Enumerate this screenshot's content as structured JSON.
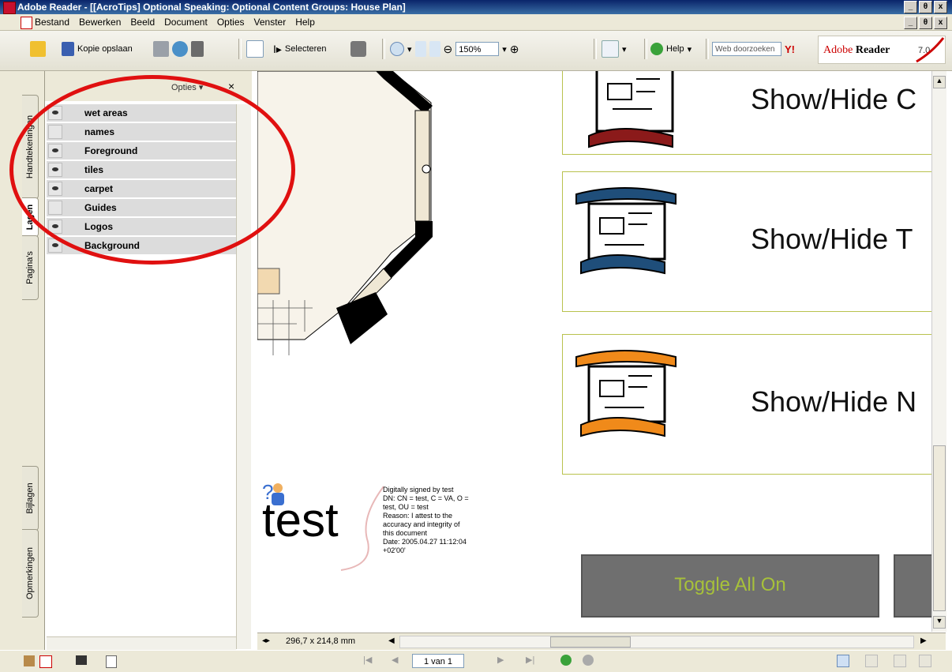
{
  "window": {
    "title": "Adobe Reader - [[AcroTips] Optional Speaking: Optional Content Groups: House Plan]",
    "controls": [
      "_",
      "θ",
      "x"
    ]
  },
  "menu": {
    "items": [
      "Bestand",
      "Bewerken",
      "Beeld",
      "Document",
      "Opties",
      "Venster",
      "Help"
    ]
  },
  "toolbar": {
    "save_copy": "Kopie opslaan",
    "select": "Selecteren",
    "zoom": "150%",
    "help": "Help",
    "search_placeholder": "Web doorzoeken",
    "brand": "Adobe",
    "brand_product": "Reader",
    "brand_version": "7.0"
  },
  "side_tabs": [
    "Handtekeningen",
    "Lagen",
    "Pagina's",
    "Bijlagen",
    "Opmerkingen"
  ],
  "layers_panel": {
    "options_label": "Opties",
    "close": "×",
    "layers": [
      {
        "name": "wet areas",
        "visible": true
      },
      {
        "name": "names",
        "visible": false
      },
      {
        "name": "Foreground",
        "visible": true
      },
      {
        "name": "tiles",
        "visible": true
      },
      {
        "name": "carpet",
        "visible": true
      },
      {
        "name": "Guides",
        "visible": false
      },
      {
        "name": "Logos",
        "visible": true
      },
      {
        "name": "Background",
        "visible": true
      }
    ]
  },
  "document": {
    "show_hide": [
      "Show/Hide C",
      "Show/Hide T",
      "Show/Hide N"
    ],
    "scroll_colors": [
      "#8b1a1a",
      "#1f4e7a",
      "#f08a1a"
    ],
    "toggle_all_on": "Toggle All On",
    "signature": {
      "name": "test",
      "lines": [
        "Digitally signed by test",
        "DN: CN = test, C = VA, O =",
        "test, OU = test",
        "Reason: I attest to the",
        "accuracy and integrity of",
        "this document",
        "Date: 2005.04.27 11:12:04",
        "+02'00'"
      ]
    }
  },
  "pagebar": {
    "dimensions": "296,7 x 214,8 mm"
  },
  "statusbar": {
    "page": "1 van 1"
  },
  "annotation_color": "#e01010"
}
